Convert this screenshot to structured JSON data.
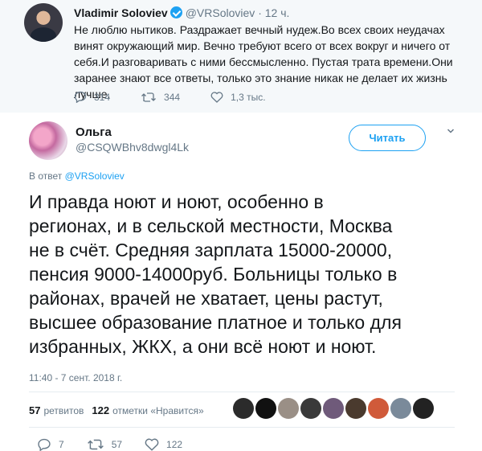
{
  "quoted_tweet": {
    "name": "Vladimir Soloviev",
    "handle": "@VRSoloviev",
    "time": "· 12 ч.",
    "text": "Не люблю нытиков. Раздражает вечный нудеж.Во всех своих неудачах винят окружающий мир. Вечно  требуют всего  от  всех вокруг и ничего от себя.И разговаривать с ними бессмысленно. Пустая трата времени.Они заранее знают все ответы, только это знание никак не делает их жизнь лучше.",
    "replies": "314",
    "retweets": "344",
    "likes": "1,3 тыс."
  },
  "tweet": {
    "name": "Ольга",
    "handle": "@CSQWBhv8dwgl4Lk",
    "follow_label": "Читать",
    "reply_prefix": "В ответ ",
    "reply_handle": "@VRSoloviev",
    "text": "И правда ноют и ноют, особенно в\nрегионах, и в сельской местности, Москва\nне в счёт. Средняя зарплата 15000-20000,\nпенсия 9000-14000руб. Больницы только в\nрайонах, врачей не хватает, цены растут,\nвысшее образование платное и только для\nизбранных, ЖКХ, а они всё ноют и ноют.",
    "timestamp": "11:40 - 7 сент. 2018 г.",
    "retweet_count": "57",
    "retweet_label": "ретвитов",
    "like_count": "122",
    "like_label": "отметки «Нравится»",
    "actions": {
      "replies": "7",
      "retweets": "57",
      "likes": "122"
    }
  },
  "colors": {
    "accent": "#1da1f2",
    "muted": "#657786",
    "quoted_bg": "#f5f8fa"
  },
  "liker_avatars": [
    "#2b2b2b",
    "#111111",
    "#9a8f86",
    "#3a3a3a",
    "#6f5a7a",
    "#4a3a2e",
    "#d05a3a",
    "#7a8a9a",
    "#222222"
  ]
}
